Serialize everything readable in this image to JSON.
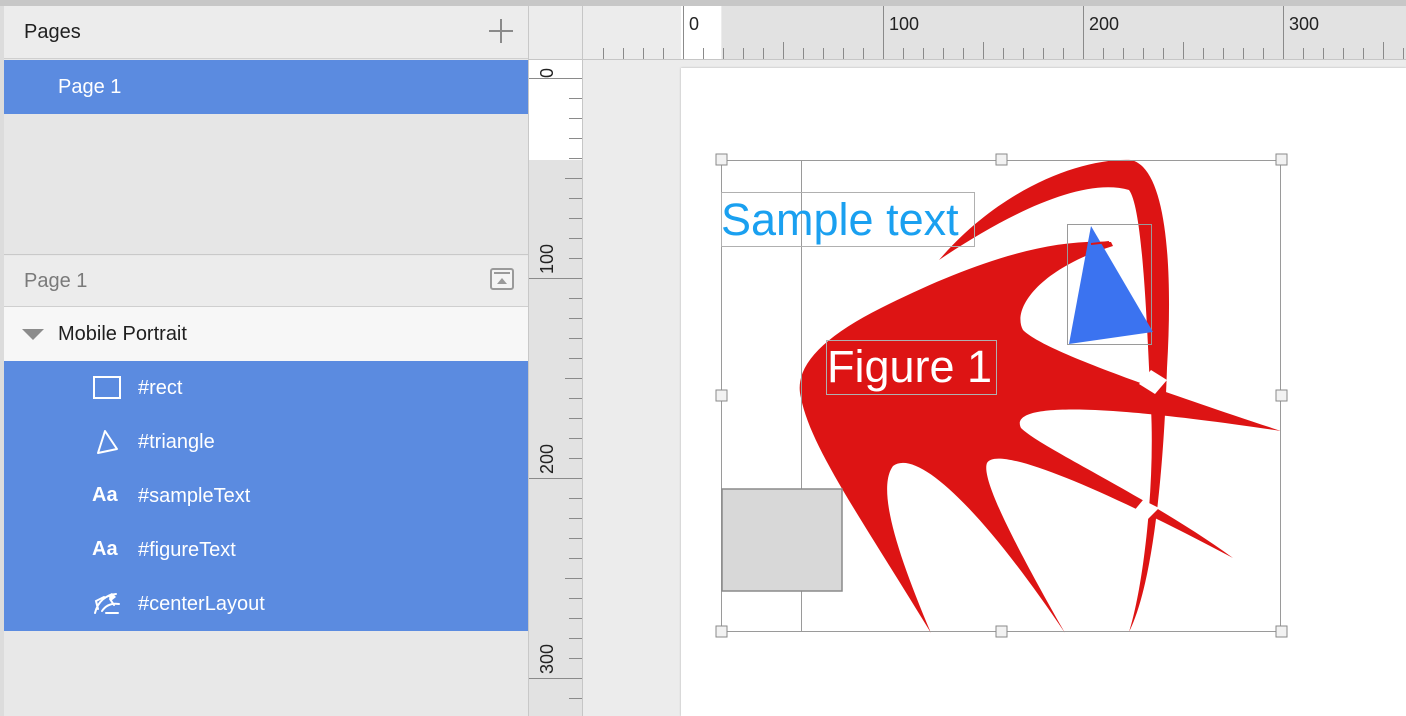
{
  "pages_panel": {
    "title": "Pages",
    "add_icon": "plus-icon",
    "pages": [
      {
        "label": "Page 1"
      }
    ]
  },
  "layers_panel": {
    "header": "Page 1",
    "collapse_icon": "collapse-panel-icon",
    "group": {
      "label": "Mobile Portrait"
    },
    "items": [
      {
        "label": "#rect",
        "icon": "rectangle-icon"
      },
      {
        "label": "#triangle",
        "icon": "triangle-icon"
      },
      {
        "label": "#sampleText",
        "icon": "text-icon",
        "icon_text": "Aa"
      },
      {
        "label": "#figureText",
        "icon": "text-icon",
        "icon_text": "Aa"
      },
      {
        "label": "#centerLayout",
        "icon": "layout-icon"
      }
    ]
  },
  "rulers": {
    "horizontal_labels": [
      "0",
      "100",
      "200",
      "300"
    ],
    "vertical_labels": [
      "0",
      "100",
      "200",
      "300"
    ]
  },
  "canvas": {
    "sample_text": "Sample text",
    "figure_text": "Figure 1",
    "colors": {
      "selection": "#5b8be0",
      "sample_text": "#1aa0f0",
      "figure_shape": "#dd1414",
      "triangle": "#3b73f0",
      "rect_fill": "#d8d8d8"
    }
  }
}
